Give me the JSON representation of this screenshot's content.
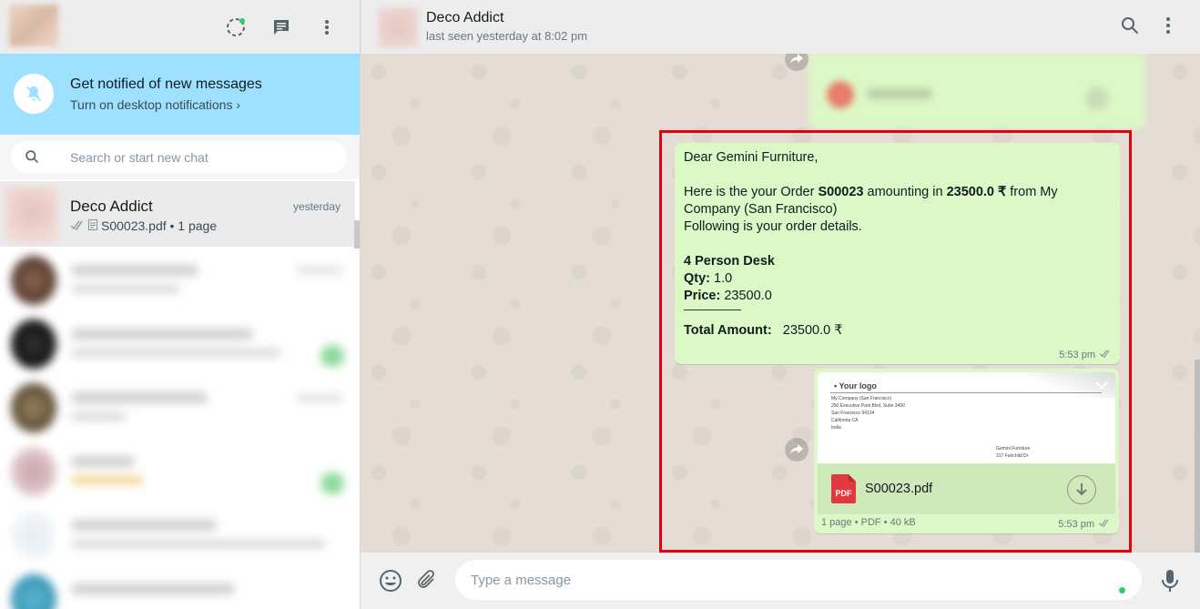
{
  "left_pane": {
    "notification": {
      "title": "Get notified of new messages",
      "link": "Turn on desktop notifications"
    },
    "search": {
      "placeholder": "Search or start new chat"
    },
    "chats": [
      {
        "name": "Deco Addict",
        "time": "yesterday",
        "preview": "S00023.pdf • 1 page",
        "status": "read"
      }
    ]
  },
  "conversation": {
    "contact_name": "Deco Addict",
    "contact_status": "last seen yesterday at 8:02 pm",
    "messages": {
      "order_text": {
        "greeting": "Dear Gemini Furniture,",
        "intro_1": "Here is the your Order ",
        "order_ref": "S00023",
        "intro_2": " amounting in ",
        "amount": "23500.0 ₹",
        "intro_3": " from My Company (San Francisco)",
        "intro_4": "Following is your order details.",
        "product_name": "4 Person Desk",
        "qty_label": "Qty:",
        "qty_value": " 1.0",
        "price_label": "Price:",
        "price_value": " 23500.0",
        "total_label": "Total Amount:",
        "total_value": "23500.0 ₹",
        "time": "5:53 pm"
      },
      "document": {
        "preview_logo": "Your logo",
        "preview_address": [
          "My Company (San Francisco)",
          "250 Executive Park Blvd, Suite 3400",
          "San Francisco 94134",
          "California CA",
          "India"
        ],
        "preview_customer": [
          "Gemini Furniture",
          "317 Fairchild Dr"
        ],
        "filename": "S00023.pdf",
        "pdf_badge": "PDF",
        "info": "1 page • PDF • 40 kB",
        "time": "5:53 pm"
      }
    },
    "composer": {
      "placeholder": "Type a message"
    }
  },
  "colors": {
    "outgoing_bubble": "#dcf8c6",
    "notification_banner": "#9de1fe",
    "highlight_box": "#e3000f",
    "wallpaper": "#e5ddd5"
  },
  "icons": [
    "status-icon",
    "new-chat-icon",
    "menu-icon",
    "bell-off-icon",
    "search-icon",
    "double-check-icon",
    "document-icon",
    "forward-icon",
    "chevron-down-icon",
    "pdf-icon",
    "download-icon",
    "emoji-icon",
    "attach-icon",
    "mic-icon"
  ]
}
